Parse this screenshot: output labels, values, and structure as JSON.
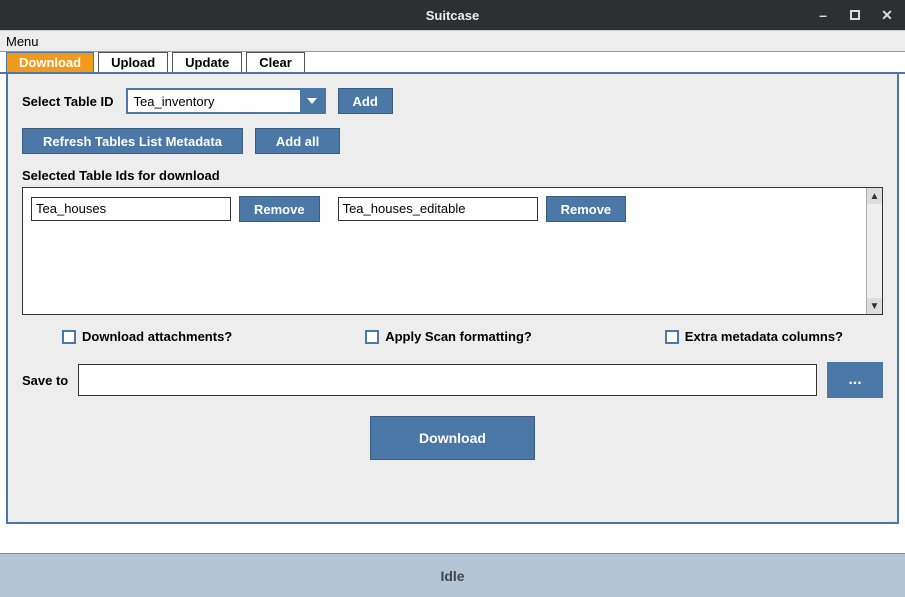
{
  "window": {
    "title": "Suitcase"
  },
  "menubar": {
    "items": [
      "Menu"
    ]
  },
  "tabs": [
    {
      "label": "Download",
      "active": true
    },
    {
      "label": "Upload",
      "active": false
    },
    {
      "label": "Update",
      "active": false
    },
    {
      "label": "Clear",
      "active": false
    }
  ],
  "select_table": {
    "label": "Select Table ID",
    "value": "Tea_inventory",
    "add_label": "Add"
  },
  "buttons": {
    "refresh_meta": "Refresh Tables List Metadata",
    "add_all": "Add all",
    "remove": "Remove",
    "download": "Download",
    "browse": "..."
  },
  "selected_section": {
    "label": "Selected Table Ids for download",
    "items": [
      {
        "name": "Tea_houses"
      },
      {
        "name": "Tea_houses_editable"
      }
    ]
  },
  "checks": {
    "attachments": "Download attachments?",
    "scan": "Apply Scan formatting?",
    "extra_meta": "Extra metadata columns?"
  },
  "save": {
    "label": "Save to",
    "value": ""
  },
  "status": {
    "text": "Idle"
  }
}
